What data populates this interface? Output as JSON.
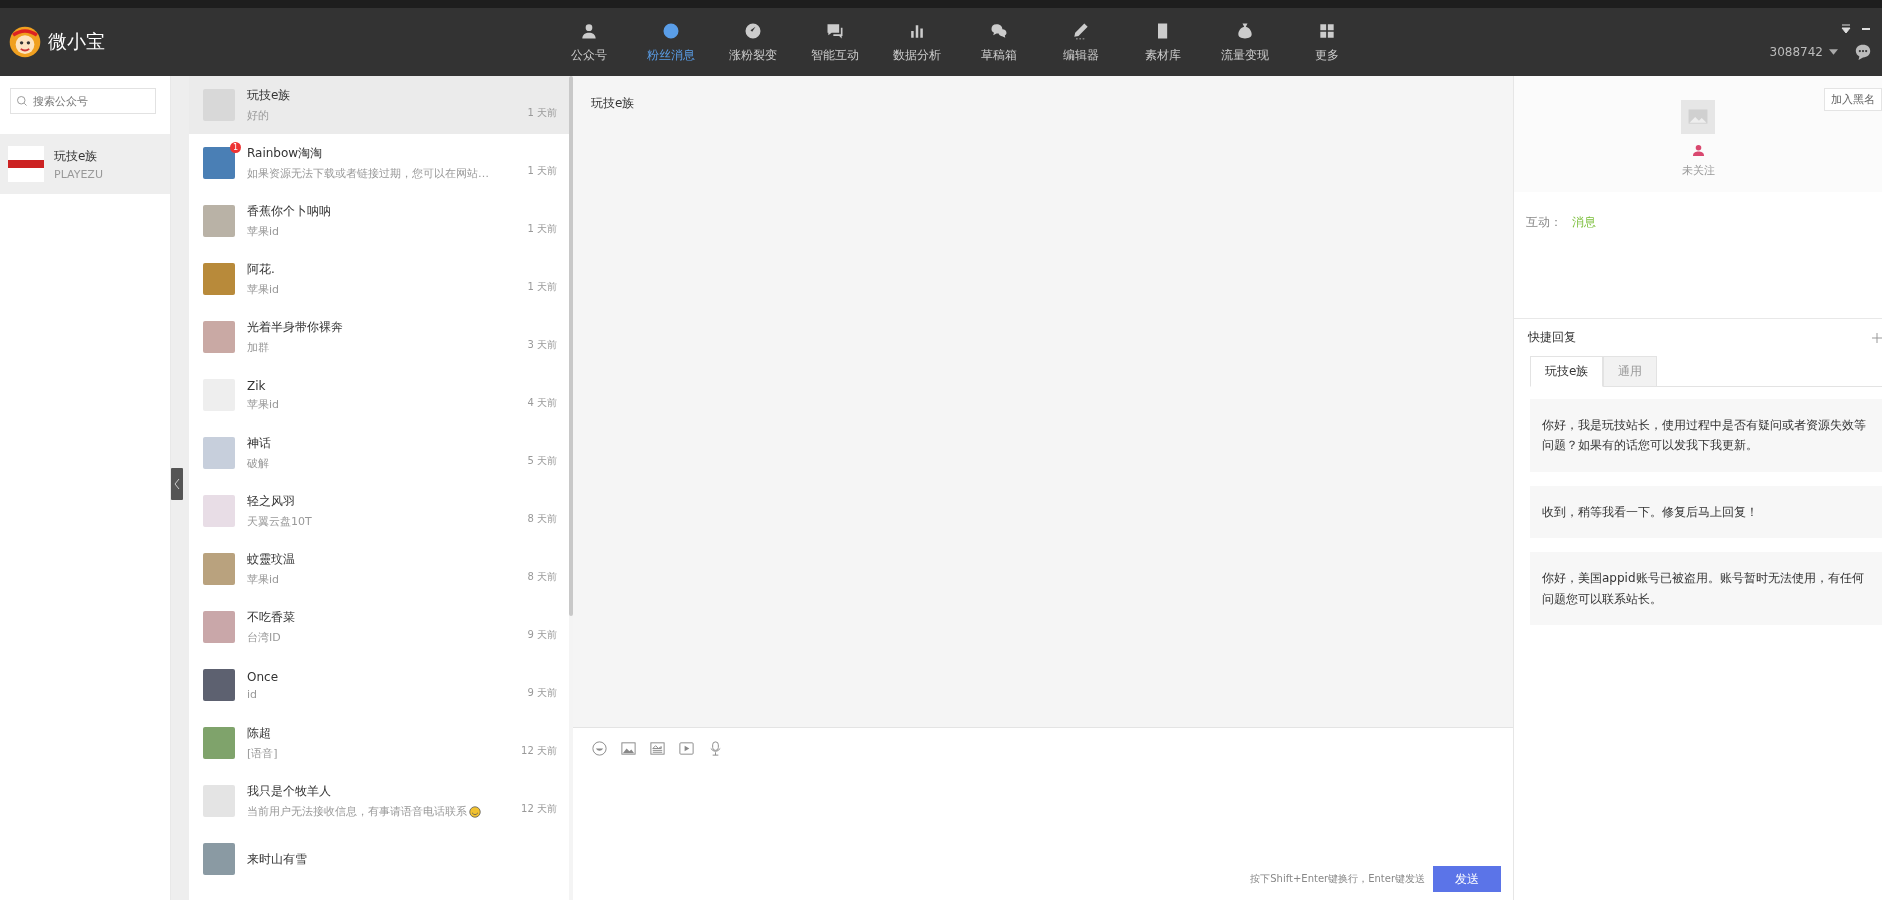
{
  "app": {
    "name": "微小宝"
  },
  "nav": [
    {
      "label": "公众号",
      "selected": false
    },
    {
      "label": "粉丝消息",
      "selected": true
    },
    {
      "label": "涨粉裂变",
      "selected": false
    },
    {
      "label": "智能互动",
      "selected": false
    },
    {
      "label": "数据分析",
      "selected": false
    },
    {
      "label": "草稿箱",
      "selected": false
    },
    {
      "label": "编辑器",
      "selected": false
    },
    {
      "label": "素材库",
      "selected": false
    },
    {
      "label": "流量变现",
      "selected": false
    },
    {
      "label": "更多",
      "selected": false
    }
  ],
  "account": {
    "id": "3088742"
  },
  "sidebar": {
    "search": {
      "placeholder": "搜索公众号"
    },
    "accounts": [
      {
        "name": "玩技e族",
        "subtitle": "PLAYEZU",
        "selected": true
      }
    ]
  },
  "conversations": [
    {
      "name": "玩技e族",
      "preview": "好的",
      "time": "1 天前",
      "selected": true
    },
    {
      "name": "Rainbow淘淘",
      "preview": "如果资源无法下载或者链接过期，您可以在网站…",
      "time": "1 天前",
      "selected": false,
      "badge": "1"
    },
    {
      "name": "香蕉你个卜呐呐",
      "preview": "苹果id",
      "time": "1 天前",
      "selected": false
    },
    {
      "name": "阿花.",
      "preview": "苹果id",
      "time": "1 天前",
      "selected": false
    },
    {
      "name": "光着半身带你裸奔",
      "preview": "加群",
      "time": "3 天前",
      "selected": false
    },
    {
      "name": "Zik",
      "preview": "苹果id",
      "time": "4 天前",
      "selected": false
    },
    {
      "name": "神话",
      "preview": "破解",
      "time": "5 天前",
      "selected": false
    },
    {
      "name": "轻之风羽",
      "preview": "天翼云盘10T",
      "time": "8 天前",
      "selected": false
    },
    {
      "name": "蚊靈玟温",
      "preview": "苹果id",
      "time": "8 天前",
      "selected": false
    },
    {
      "name": "不吃香菜",
      "preview": "台湾ID",
      "time": "9 天前",
      "selected": false
    },
    {
      "name": "Once",
      "preview": "id",
      "time": "9 天前",
      "selected": false
    },
    {
      "name": "陈超",
      "preview": "[语音]",
      "time": "12 天前",
      "selected": false
    },
    {
      "name": "我只是个牧羊人",
      "preview": "当前用户无法接收信息，有事请语音电话联系",
      "time": "12 天前",
      "selected": false,
      "emoji": true
    },
    {
      "name": "来时山有雪",
      "selected": false
    }
  ],
  "chat": {
    "title": "玩技e族",
    "hint": "按下Shift+Enter键换行，Enter键发送",
    "send": "发送"
  },
  "profile": {
    "blacklist_button": "加入黑名",
    "follow_status": "未关注",
    "interaction_label": "互动：",
    "interaction_value": "消息"
  },
  "quick_reply": {
    "title": "快捷回复",
    "tabs": [
      {
        "label": "玩技e族",
        "selected": true
      },
      {
        "label": "通用",
        "selected": false
      }
    ],
    "replies": [
      "你好，我是玩技站长，使用过程中是否有疑问或者资源失效等问题？如果有的话您可以发我下我更新。",
      "收到，稍等我看一下。修复后马上回复！",
      "你好，美国appid账号已被盗用。账号暂时无法使用，有任何问题您可以联系站长。"
    ]
  }
}
